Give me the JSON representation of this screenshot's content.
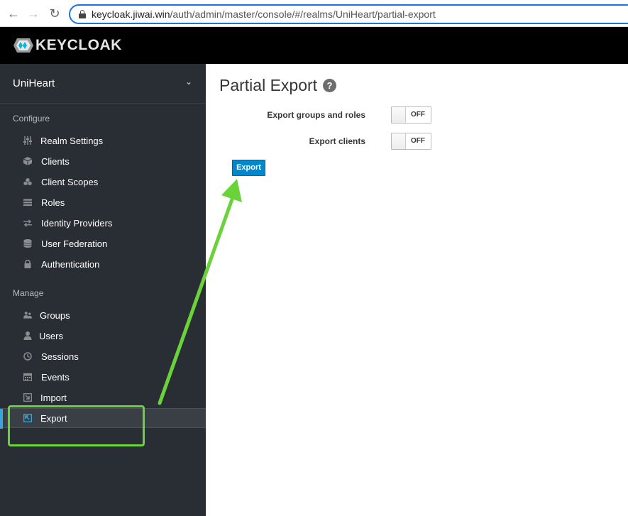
{
  "browser": {
    "url_domain": "keycloak.jiwai.win",
    "url_path": "/auth/admin/master/console/#/realms/UniHeart/partial-export"
  },
  "header": {
    "logo_text": "KEYCLOAK"
  },
  "sidebar": {
    "realm": "UniHeart",
    "configure_label": "Configure",
    "manage_label": "Manage",
    "configure_items": [
      {
        "label": "Realm Settings",
        "icon": "sliders-icon"
      },
      {
        "label": "Clients",
        "icon": "cube-icon"
      },
      {
        "label": "Client Scopes",
        "icon": "cubes-icon"
      },
      {
        "label": "Roles",
        "icon": "list-icon"
      },
      {
        "label": "Identity Providers",
        "icon": "exchange-icon"
      },
      {
        "label": "User Federation",
        "icon": "database-icon"
      },
      {
        "label": "Authentication",
        "icon": "lock-icon"
      }
    ],
    "manage_items": [
      {
        "label": "Groups",
        "icon": "users-icon"
      },
      {
        "label": "Users",
        "icon": "user-icon"
      },
      {
        "label": "Sessions",
        "icon": "clock-icon"
      },
      {
        "label": "Events",
        "icon": "calendar-icon"
      },
      {
        "label": "Import",
        "icon": "import-icon"
      },
      {
        "label": "Export",
        "icon": "export-icon"
      }
    ],
    "active_item": "Export"
  },
  "main": {
    "title": "Partial Export",
    "help_glyph": "?",
    "export_groups_label": "Export groups and roles",
    "export_groups_state": "OFF",
    "export_clients_label": "Export clients",
    "export_clients_state": "OFF",
    "export_button": "Export"
  },
  "colors": {
    "sidebar_bg": "#292e34",
    "header_bg": "#000000",
    "accent": "#39a5dc",
    "primary_button": "#0088ce",
    "annotation": "#6ad33a"
  }
}
